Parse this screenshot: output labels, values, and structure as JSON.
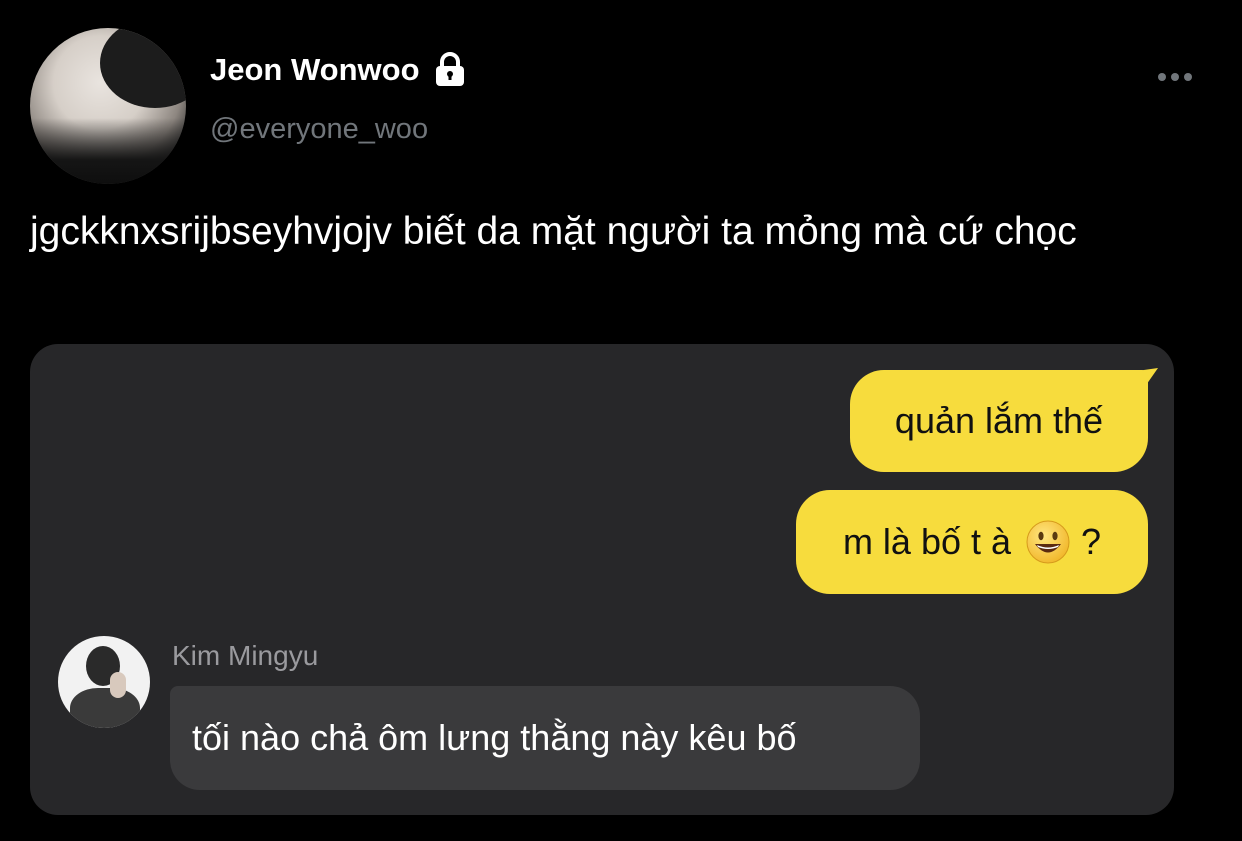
{
  "tweet": {
    "author": {
      "display_name": "Jeon Wonwoo",
      "handle": "@everyone_woo",
      "protected_icon": "lock-icon"
    },
    "more_icon": "more-options-icon",
    "text": "jgckknxsrijbseyhvjojv biết da mặt người ta mỏng mà cứ chọc"
  },
  "chat": {
    "messages_me": [
      {
        "text": "quản lắm thế"
      },
      {
        "text_before": "m là bố t à",
        "emoji": "grinning-face-emoji",
        "text_after": "?"
      }
    ],
    "friend": {
      "name": "Kim Mingyu",
      "message": "tối nào chả ôm lưng thằng này kêu bố"
    }
  },
  "colors": {
    "background": "#000000",
    "handle_gray": "#71767b",
    "chat_background": "#272729",
    "my_bubble": "#f7dc3d",
    "their_bubble": "#3a3a3c"
  }
}
